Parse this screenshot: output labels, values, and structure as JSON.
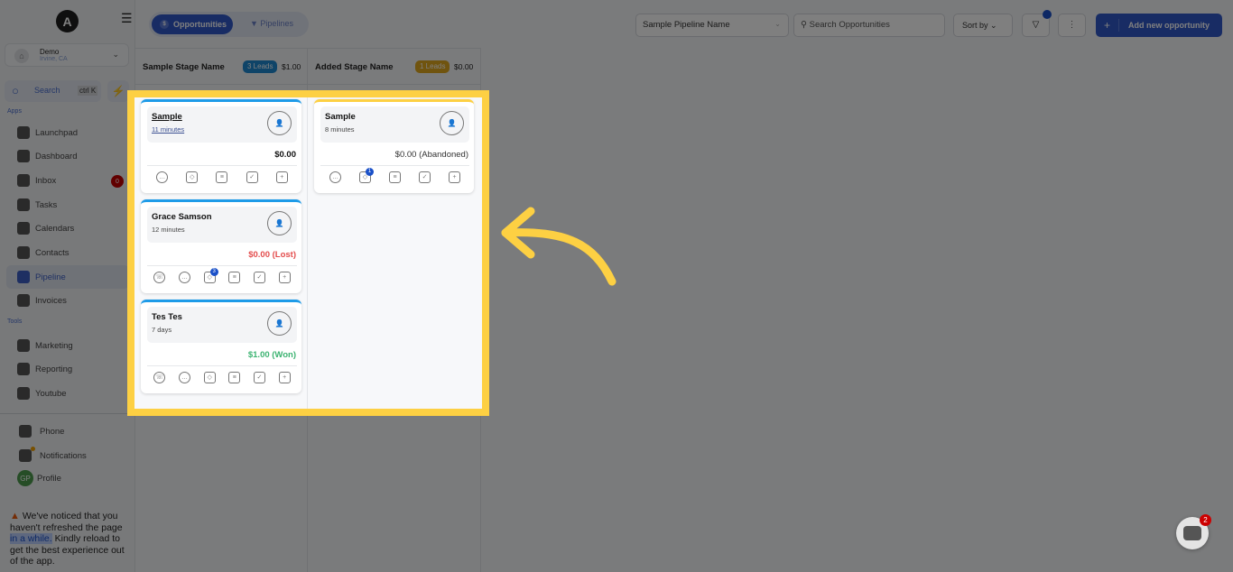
{
  "sidebar": {
    "logo": "A",
    "location": {
      "name": "Demo",
      "sub": "Irvine, CA"
    },
    "search": {
      "label": "Search",
      "shortcut": "ctrl K"
    },
    "apps_label": "Apps",
    "tools_label": "Tools",
    "apps": [
      {
        "label": "Launchpad",
        "icon": "rocket-icon"
      },
      {
        "label": "Dashboard",
        "icon": "grid-icon"
      },
      {
        "label": "Inbox",
        "icon": "inbox-icon",
        "badge": "0"
      },
      {
        "label": "Tasks",
        "icon": "clipboard-icon"
      },
      {
        "label": "Calendars",
        "icon": "calendar-icon"
      },
      {
        "label": "Contacts",
        "icon": "user-icon"
      },
      {
        "label": "Pipeline",
        "icon": "funnel-icon",
        "active": true
      },
      {
        "label": "Invoices",
        "icon": "invoice-icon"
      }
    ],
    "tools": [
      {
        "label": "Marketing",
        "icon": "megaphone-icon"
      },
      {
        "label": "Reporting",
        "icon": "pie-chart-icon"
      },
      {
        "label": "Youtube",
        "icon": "youtube-icon"
      }
    ],
    "bottom": [
      {
        "label": "Phone",
        "icon": "phone-icon"
      },
      {
        "label": "Notifications",
        "icon": "bell-icon"
      },
      {
        "label": "Profile",
        "avatar": "GP"
      }
    ],
    "warning": {
      "pre": "We've noticed that you haven't refreshed the page",
      "link": "in a while.",
      "post": "Kindly reload to get the best experience out of the app."
    }
  },
  "header": {
    "tabs": [
      {
        "label": "Opportunities",
        "active": true
      },
      {
        "label": "Pipelines",
        "active": false
      }
    ],
    "pipeline_select": "Sample Pipeline Name",
    "search_placeholder": "Search Opportunities",
    "sort_label": "Sort by",
    "add_label": "Add new opportunity"
  },
  "stages": [
    {
      "name": "Sample Stage Name",
      "leads": "3 Leads",
      "amount": "$1.00",
      "color": "#1e9be8",
      "cards": [
        {
          "title": "Sample",
          "age": "11 minutes",
          "value": "$0.00",
          "value_color": "#111111",
          "underline": true,
          "icons": [
            "chat-icon",
            "tag-icon",
            "note-icon",
            "task-icon",
            "appointment-icon"
          ]
        },
        {
          "title": "Grace Samson",
          "age": "12 minutes",
          "value": "$0.00 (Lost)",
          "value_color": "#e34c4c",
          "icons": [
            "call-icon",
            "chat-icon",
            "tag-icon",
            "note-icon",
            "task-icon",
            "appointment-icon"
          ],
          "tag_badge": "3"
        },
        {
          "title": "Tes Tes",
          "age": "7 days",
          "value": "$1.00 (Won)",
          "value_color": "#3cb371",
          "icons": [
            "call-icon",
            "chat-icon",
            "tag-icon",
            "note-icon",
            "task-icon",
            "appointment-icon"
          ]
        }
      ]
    },
    {
      "name": "Added Stage Name",
      "leads": "1 Leads",
      "amount": "$0.00",
      "color": "#e0a81f",
      "cards": [
        {
          "title": "Sample",
          "age": "8 minutes",
          "value": "$0.00 (Abandoned)",
          "value_color": "#333333",
          "icons": [
            "chat-icon",
            "tag-icon",
            "note-icon",
            "task-icon",
            "appointment-icon"
          ],
          "tag_badge": "1"
        }
      ]
    }
  ],
  "chat_widget": {
    "count": "2"
  },
  "colors": {
    "accent": "#3158c8",
    "highlight": "#fdd043"
  }
}
